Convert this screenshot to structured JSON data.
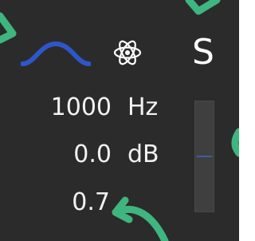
{
  "filter": {
    "shape_icon": "bell-curve-icon",
    "mode_icon": "atom-icon",
    "solo_label": "S",
    "frequency": "1000",
    "frequency_unit": "Hz",
    "gain": "0.0",
    "gain_unit": "dB",
    "q": "0.7",
    "gain_slider_level": 0.5
  },
  "colors": {
    "panel": "#2b2b2b",
    "curve": "#2f56c9",
    "text": "#f2f2f2",
    "meter": "#3f3f3f",
    "meter_mark": "#3f5ea3",
    "annotation_green": "#3fb57f"
  }
}
